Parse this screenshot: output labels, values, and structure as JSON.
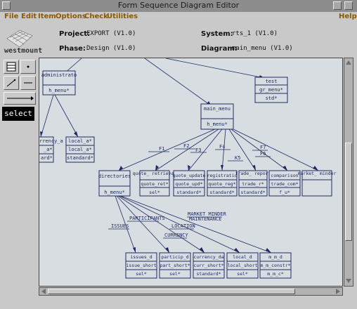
{
  "window": {
    "title": "Form Sequence Diagram Editor"
  },
  "menu": {
    "file": "File",
    "edit": "Edit",
    "item": "Item",
    "options": "Options",
    "check": "Check",
    "utilities": "Utilities",
    "help": "Help"
  },
  "logo": {
    "text": "westmount"
  },
  "header": {
    "project_label": "Project:",
    "project_value": "EXPORT (V1.0)",
    "phase_label": "Phase:",
    "phase_value": "Design (V1.0)",
    "system_label": "System:",
    "system_value": "rts_1 (V1.0)",
    "diagram_label": "Diagram:",
    "diagram_value": "main_menu (V1.0)"
  },
  "toolbar": {
    "select_label": "select"
  },
  "diagram": {
    "nodes": {
      "administrator": {
        "title": "administrato",
        "row1": "h_menu*"
      },
      "test": {
        "title": "test",
        "row1": "gr_menu*",
        "row2": "std*"
      },
      "main_menu": {
        "title": "main_menu",
        "row1": "h_menu*"
      },
      "currency_a": {
        "title": "rrency_a",
        "row1": "_a*",
        "row2": "ard*"
      },
      "local_a": {
        "title": "local_a*",
        "row1": "local_a*",
        "row2": "standard*"
      },
      "directories": {
        "title": "directories",
        "row1": "h_menu*"
      },
      "quote_retrieval": {
        "title": "quote_ retrieval",
        "row1": "quote_ret*",
        "row2": "sel*"
      },
      "quote_update": {
        "title": "quote_update",
        "row1": "quote_upd*",
        "row2": "standard*"
      },
      "registration": {
        "title": "registratio",
        "row1": "quote_reg*",
        "row2": "standard*"
      },
      "trade_report": {
        "title": "trade_ report",
        "row1": "trade_r*",
        "row2": "standard*"
      },
      "comparison": {
        "title": "comparison",
        "row1": "trade_com*",
        "row2": "f_u*"
      },
      "market_minder": {
        "title": "market_ minder"
      },
      "issues_d": {
        "title": "issues_d",
        "row1": "issue_short",
        "row2": "sel*"
      },
      "particip_d": {
        "title": "particip_d",
        "row1": "part_short*",
        "row2": "sel*"
      },
      "currency_da": {
        "title": "currency_da",
        "row1": "curr_short*",
        "row2": "standard*"
      },
      "local_d": {
        "title": "local_d",
        "row1": "local_short",
        "row2": "sel*"
      },
      "m_m_d": {
        "title": "m_m_d",
        "row1": "m_m_constr*",
        "row2": "m_m_c*"
      }
    },
    "edges": {
      "f1": "F1",
      "f2": "F2",
      "f3": "F3",
      "f4": "F4",
      "k5": "K5",
      "f6": "F6",
      "f7": "F7",
      "issues": "ISSUES",
      "participants": "PARTICIPANTS",
      "location": "LOCATION",
      "currency": "CURRENCY",
      "market_minder_1": "MARKET MINDER",
      "market_minder_2": "MAINTENANCE"
    }
  },
  "colors": {
    "canvas": "#d8dde2",
    "ink": "#1f2a63",
    "menu_text": "#8a5a00",
    "titlebar": "#8d8d8d"
  }
}
